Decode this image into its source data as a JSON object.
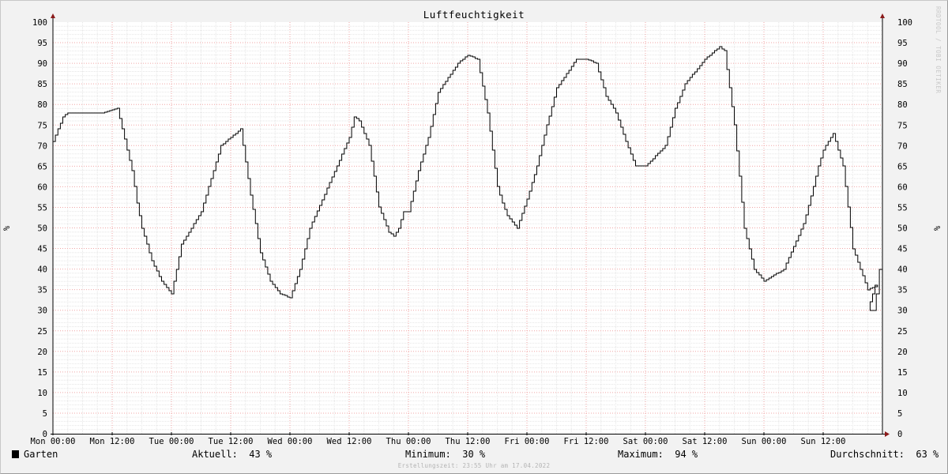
{
  "chart_data": {
    "type": "line",
    "title": "Luftfeuchtigkeit",
    "ylabel": "%",
    "ylim": [
      0,
      100
    ],
    "yticks": [
      0,
      5,
      10,
      15,
      20,
      25,
      30,
      35,
      40,
      45,
      50,
      55,
      60,
      65,
      70,
      75,
      80,
      85,
      90,
      95,
      100
    ],
    "xticks": [
      "Mon 00:00",
      "Mon 12:00",
      "Tue 00:00",
      "Tue 12:00",
      "Wed 00:00",
      "Wed 12:00",
      "Thu 00:00",
      "Thu 12:00",
      "Fri 00:00",
      "Fri 12:00",
      "Sat 00:00",
      "Sat 12:00",
      "Sun 00:00",
      "Sun 12:00"
    ],
    "xrange_hours": [
      0,
      168
    ],
    "grid": true,
    "series": [
      {
        "name": "Garten",
        "color": "#000000",
        "x_hours": [
          0,
          1,
          2,
          3,
          4,
          6,
          10,
          13,
          16,
          17,
          18,
          20,
          22,
          24,
          26,
          30,
          34,
          35,
          36,
          38,
          40,
          42,
          44,
          46,
          48,
          50,
          52,
          56,
          60,
          61,
          62,
          64,
          66,
          68,
          69,
          70,
          71,
          72,
          74,
          76,
          78,
          82,
          84,
          86,
          88,
          90,
          91,
          92,
          94,
          96,
          98,
          100,
          102,
          106,
          108,
          110,
          112,
          113,
          114,
          116,
          118,
          120,
          124,
          126,
          128,
          130,
          132,
          134,
          135,
          136,
          138,
          140,
          142,
          144,
          148,
          152,
          154,
          155,
          156,
          158,
          160,
          162,
          165,
          167,
          168
        ],
        "y": [
          71,
          74,
          77,
          78,
          78,
          78,
          78,
          79,
          64,
          56,
          50,
          42,
          37,
          34,
          46,
          54,
          70,
          71,
          72,
          74,
          58,
          44,
          37,
          34,
          33,
          40,
          50,
          61,
          72,
          77,
          76,
          70,
          55,
          49,
          48,
          50,
          54,
          54,
          64,
          72,
          83,
          90,
          92,
          91,
          78,
          60,
          56,
          53,
          50,
          57,
          65,
          75,
          84,
          91,
          91,
          90,
          82,
          80,
          78,
          71,
          65,
          65,
          70,
          79,
          85,
          88,
          91,
          93,
          94,
          93,
          75,
          50,
          40,
          37,
          40,
          51,
          60,
          65,
          69,
          73,
          65,
          45,
          35,
          36,
          33
        ],
        "y_tail": [
          30,
          30,
          34,
          40,
          43
        ]
      }
    ],
    "legend": {
      "label": "Garten",
      "aktuell_label": "Aktuell:",
      "aktuell_value": "43 %",
      "minimum_label": "Minimum:",
      "minimum_value": "30 %",
      "maximum_label": "Maximum:",
      "maximum_value": "94 %",
      "durchschnitt_label": "Durchschnitt:",
      "durchschnitt_value": "63 %"
    },
    "created": "Erstellungszeit: 23:55 Uhr am 17.04.2022",
    "watermark": "RRDTOOL / TOBI OETIKER"
  }
}
